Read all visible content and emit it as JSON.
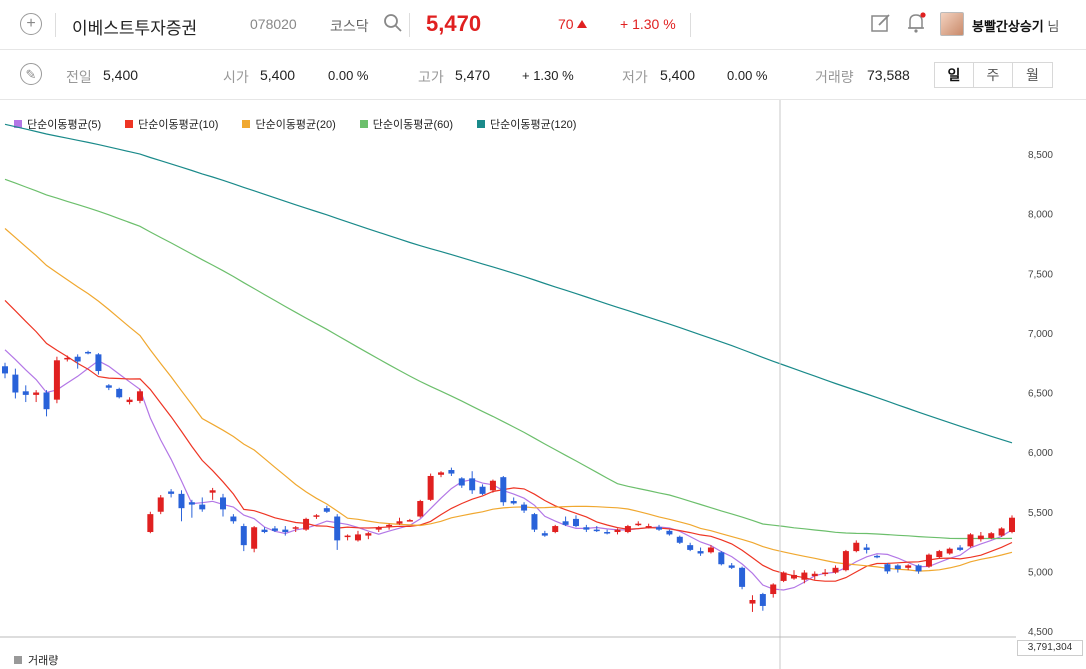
{
  "header": {
    "stock_name": "이베스트투자증권",
    "code": "078020",
    "market": "코스닥",
    "price": "5,470",
    "change": "70",
    "change_pct": "+ 1.30 %",
    "user_name": "봉빨간상승기",
    "user_suffix": "님"
  },
  "summary": {
    "prev_label": "전일",
    "prev_value": "5,400",
    "open_label": "시가",
    "open_value": "5,400",
    "open_pct": "0.00 %",
    "high_label": "고가",
    "high_value": "5,470",
    "high_pct": "+ 1.30 %",
    "low_label": "저가",
    "low_value": "5,400",
    "low_pct": "0.00 %",
    "volume_label": "거래량",
    "volume_value": "73,588"
  },
  "periods": [
    "일",
    "주",
    "월"
  ],
  "colors": {
    "up": "#e02020",
    "down": "#2962d9",
    "ma5": "#b377e6",
    "ma10": "#ee3524",
    "ma20": "#f0a830",
    "ma60": "#6cbf6c",
    "ma120": "#1a8a8a"
  },
  "volume": {
    "label": "거래량",
    "value": "3,791,304"
  },
  "chart_data": {
    "type": "candlestick",
    "y_ticks": [
      "8,500",
      "8,000",
      "7,500",
      "7,000",
      "6,500",
      "6,000",
      "5,500",
      "5,000",
      "4,500"
    ],
    "ylim": [
      4500,
      8500
    ],
    "legend": [
      "단순이동평균(5)",
      "단순이동평균(10)",
      "단순이동평균(20)",
      "단순이동평균(60)",
      "단순이동평균(120)"
    ],
    "candles": [
      [
        6720,
        6750,
        6620,
        6660
      ],
      [
        6650,
        6700,
        6450,
        6500
      ],
      [
        6510,
        6560,
        6420,
        6480
      ],
      [
        6480,
        6520,
        6420,
        6500
      ],
      [
        6500,
        6520,
        6300,
        6360
      ],
      [
        6440,
        6800,
        6410,
        6770
      ],
      [
        6780,
        6810,
        6760,
        6790
      ],
      [
        6800,
        6820,
        6700,
        6760
      ],
      [
        6840,
        6850,
        6820,
        6830
      ],
      [
        6820,
        6830,
        6650,
        6680
      ],
      [
        6560,
        6570,
        6520,
        6540
      ],
      [
        6530,
        6540,
        6450,
        6460
      ],
      [
        6420,
        6460,
        6400,
        6440
      ],
      [
        6430,
        6530,
        6410,
        6510
      ],
      [
        5330,
        5500,
        5320,
        5480
      ],
      [
        5500,
        5640,
        5480,
        5620
      ],
      [
        5670,
        5690,
        5620,
        5650
      ],
      [
        5650,
        5680,
        5420,
        5530
      ],
      [
        5580,
        5600,
        5450,
        5560
      ],
      [
        5560,
        5620,
        5500,
        5520
      ],
      [
        5660,
        5700,
        5600,
        5680
      ],
      [
        5620,
        5650,
        5460,
        5520
      ],
      [
        5460,
        5480,
        5400,
        5420
      ],
      [
        5380,
        5400,
        5170,
        5220
      ],
      [
        5190,
        5380,
        5160,
        5370
      ],
      [
        5350,
        5370,
        5320,
        5330
      ],
      [
        5360,
        5380,
        5330,
        5340
      ],
      [
        5350,
        5380,
        5300,
        5330
      ],
      [
        5360,
        5380,
        5330,
        5370
      ],
      [
        5350,
        5450,
        5340,
        5440
      ],
      [
        5460,
        5480,
        5440,
        5470
      ],
      [
        5530,
        5550,
        5490,
        5500
      ],
      [
        5460,
        5480,
        5180,
        5260
      ],
      [
        5290,
        5310,
        5260,
        5300
      ],
      [
        5260,
        5340,
        5250,
        5310
      ],
      [
        5300,
        5330,
        5270,
        5320
      ],
      [
        5350,
        5380,
        5330,
        5370
      ],
      [
        5380,
        5400,
        5350,
        5390
      ],
      [
        5400,
        5450,
        5390,
        5420
      ],
      [
        5430,
        5440,
        5420,
        5430
      ],
      [
        5460,
        5600,
        5450,
        5590
      ],
      [
        5600,
        5820,
        5590,
        5800
      ],
      [
        5810,
        5840,
        5790,
        5830
      ],
      [
        5850,
        5870,
        5800,
        5820
      ],
      [
        5780,
        5790,
        5700,
        5720
      ],
      [
        5780,
        5840,
        5650,
        5680
      ],
      [
        5710,
        5730,
        5640,
        5650
      ],
      [
        5680,
        5770,
        5660,
        5760
      ],
      [
        5790,
        5800,
        5550,
        5580
      ],
      [
        5590,
        5620,
        5560,
        5570
      ],
      [
        5560,
        5580,
        5490,
        5510
      ],
      [
        5480,
        5490,
        5330,
        5350
      ],
      [
        5320,
        5340,
        5290,
        5300
      ],
      [
        5330,
        5390,
        5320,
        5380
      ],
      [
        5420,
        5460,
        5380,
        5390
      ],
      [
        5440,
        5470,
        5370,
        5380
      ],
      [
        5370,
        5390,
        5330,
        5350
      ],
      [
        5350,
        5380,
        5330,
        5340
      ],
      [
        5330,
        5350,
        5310,
        5320
      ],
      [
        5330,
        5360,
        5310,
        5350
      ],
      [
        5330,
        5390,
        5320,
        5380
      ],
      [
        5390,
        5420,
        5380,
        5400
      ],
      [
        5380,
        5400,
        5360,
        5380
      ],
      [
        5370,
        5390,
        5340,
        5350
      ],
      [
        5340,
        5350,
        5300,
        5310
      ],
      [
        5290,
        5300,
        5230,
        5240
      ],
      [
        5220,
        5240,
        5170,
        5180
      ],
      [
        5170,
        5200,
        5130,
        5150
      ],
      [
        5160,
        5220,
        5150,
        5200
      ],
      [
        5160,
        5170,
        5050,
        5060
      ],
      [
        5050,
        5070,
        5020,
        5030
      ],
      [
        5030,
        5040,
        4850,
        4870
      ],
      [
        4730,
        4800,
        4660,
        4760
      ],
      [
        4810,
        4820,
        4670,
        4710
      ],
      [
        4810,
        4900,
        4780,
        4890
      ],
      [
        4920,
        5000,
        4910,
        4990
      ],
      [
        4940,
        5010,
        4930,
        4970
      ],
      [
        4930,
        5010,
        4900,
        4990
      ],
      [
        4960,
        5000,
        4930,
        4980
      ],
      [
        4990,
        5020,
        4960,
        4990
      ],
      [
        4990,
        5050,
        4980,
        5030
      ],
      [
        5010,
        5180,
        5000,
        5170
      ],
      [
        5170,
        5260,
        5160,
        5240
      ],
      [
        5200,
        5230,
        5150,
        5180
      ],
      [
        5130,
        5140,
        5110,
        5120
      ],
      [
        5060,
        5070,
        4980,
        5000
      ],
      [
        5050,
        5060,
        4990,
        5020
      ],
      [
        5030,
        5060,
        5010,
        5050
      ],
      [
        5050,
        5060,
        4980,
        5000
      ],
      [
        5040,
        5150,
        5030,
        5140
      ],
      [
        5120,
        5180,
        5110,
        5170
      ],
      [
        5150,
        5200,
        5140,
        5190
      ],
      [
        5200,
        5220,
        5170,
        5180
      ],
      [
        5210,
        5320,
        5200,
        5310
      ],
      [
        5270,
        5330,
        5250,
        5300
      ],
      [
        5280,
        5330,
        5270,
        5320
      ],
      [
        5300,
        5370,
        5290,
        5360
      ],
      [
        5330,
        5470,
        5320,
        5450
      ]
    ]
  }
}
